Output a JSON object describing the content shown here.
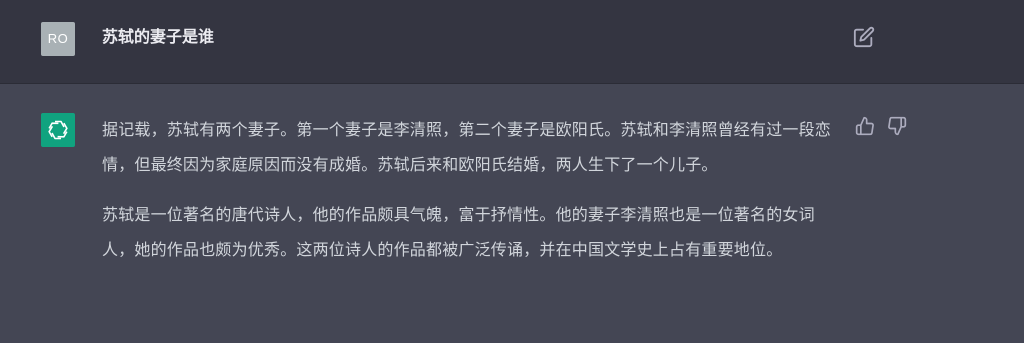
{
  "user_message": {
    "avatar_initials": "RO",
    "text": "苏轼的妻子是谁"
  },
  "assistant_message": {
    "paragraphs": [
      "据记载，苏轼有两个妻子。第一个妻子是李清照，第二个妻子是欧阳氏。苏轼和李清照曾经有过一段恋情，但最终因为家庭原因而没有成婚。苏轼后来和欧阳氏结婚，两人生下了一个儿子。",
      "苏轼是一位著名的唐代诗人，他的作品颇具气魄，富于抒情性。他的妻子李清照也是一位著名的女词人，她的作品也颇为优秀。这两位诗人的作品都被广泛传诵，并在中国文学史上占有重要地位。"
    ]
  },
  "icons": {
    "edit": "edit-icon",
    "thumbs_up": "thumbs-up-icon",
    "thumbs_down": "thumbs-down-icon",
    "assistant_logo": "openai-logo-icon"
  },
  "colors": {
    "user_row_bg": "#343541",
    "assistant_row_bg": "#444654",
    "assistant_avatar_bg": "#10a37f",
    "user_avatar_bg": "#a9b1b5",
    "text": "#d1d5db"
  }
}
